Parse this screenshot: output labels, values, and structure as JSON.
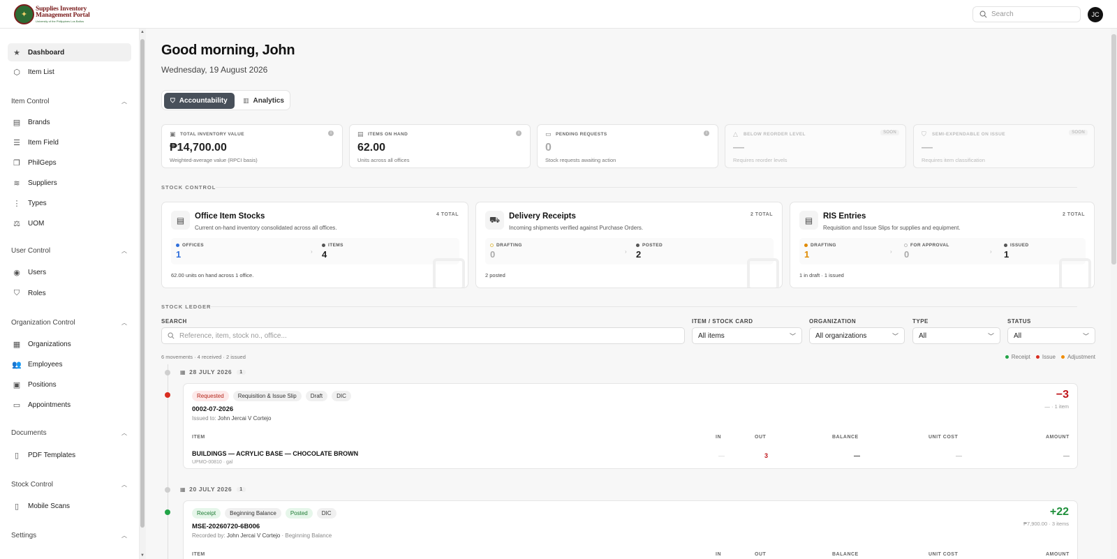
{
  "app": {
    "logo_line1": "Supplies Inventory",
    "logo_line2": "Management Portal",
    "logo_line3": "University of the Philippines Los Baños",
    "search_placeholder": "Search",
    "user_initials": "JC"
  },
  "sidebar": {
    "top_items": [
      {
        "label": "Dashboard",
        "icon": "star-icon"
      },
      {
        "label": "Item List",
        "icon": "box-icon"
      }
    ],
    "sections": [
      {
        "title": "Item Control",
        "items": [
          {
            "label": "Brands",
            "icon": "archive-icon"
          },
          {
            "label": "Item Field",
            "icon": "sliders-icon"
          },
          {
            "label": "PhilGeps",
            "icon": "files-icon"
          },
          {
            "label": "Suppliers",
            "icon": "stack-icon"
          },
          {
            "label": "Types",
            "icon": "list-icon"
          },
          {
            "label": "UOM",
            "icon": "scale-icon"
          }
        ]
      },
      {
        "title": "User Control",
        "items": [
          {
            "label": "Users",
            "icon": "user-circle-icon"
          },
          {
            "label": "Roles",
            "icon": "shield-icon"
          }
        ]
      },
      {
        "title": "Organization Control",
        "items": [
          {
            "label": "Organizations",
            "icon": "building-icon"
          },
          {
            "label": "Employees",
            "icon": "people-icon"
          },
          {
            "label": "Positions",
            "icon": "briefcase-icon"
          },
          {
            "label": "Appointments",
            "icon": "id-card-icon"
          }
        ]
      },
      {
        "title": "Documents",
        "items": [
          {
            "label": "PDF Templates",
            "icon": "document-icon"
          }
        ]
      },
      {
        "title": "Stock Control",
        "items": [
          {
            "label": "Mobile Scans",
            "icon": "phone-icon"
          }
        ]
      },
      {
        "title": "Settings",
        "items": []
      }
    ]
  },
  "header": {
    "greeting": "Good morning, John",
    "date": "Wednesday, 19 August 2026",
    "tabs": [
      "Accountability",
      "Analytics"
    ]
  },
  "kpis": [
    {
      "label": "TOTAL INVENTORY VALUE",
      "value": "₱14,700.00",
      "sub": "Weighted-average value (RPCI basis)",
      "icon": "wallet-icon",
      "state": "info"
    },
    {
      "label": "ITEMS ON HAND",
      "value": "62.00",
      "sub": "Units across all offices",
      "icon": "archive-icon",
      "state": "info"
    },
    {
      "label": "PENDING REQUESTS",
      "value": "0",
      "sub": "Stock requests awaiting action",
      "icon": "inbox-icon",
      "state": "info"
    },
    {
      "label": "BELOW REORDER LEVEL",
      "value": "—",
      "sub": "Requires reorder levels",
      "icon": "warning-icon",
      "state": "SOON"
    },
    {
      "label": "SEMI-EXPENDABLE ON ISSUE",
      "value": "—",
      "sub": "Requires item classification",
      "icon": "check-shield-icon",
      "state": "SOON"
    }
  ],
  "stock_control": {
    "label": "STOCK CONTROL",
    "cards": [
      {
        "title": "Office Item Stocks",
        "desc": "Current on-hand inventory consolidated across all offices.",
        "total": "4 TOTAL",
        "icon": "archive-icon",
        "stats": [
          {
            "label": "OFFICES",
            "value": "1",
            "color": "#2f6fdb"
          },
          {
            "label": "ITEMS",
            "value": "4",
            "color": "#555555"
          }
        ],
        "foot": "62.00 units on hand across 1 office."
      },
      {
        "title": "Delivery Receipts",
        "desc": "Incoming shipments verified against Purchase Orders.",
        "total": "2 TOTAL",
        "icon": "truck-icon",
        "stats": [
          {
            "label": "DRAFTING",
            "value": "0",
            "color": "#e0c15a"
          },
          {
            "label": "POSTED",
            "value": "2",
            "color": "#555555"
          }
        ],
        "foot": "2 posted"
      },
      {
        "title": "RIS Entries",
        "desc": "Requisition and Issue Slips for supplies and equipment.",
        "total": "2 TOTAL",
        "icon": "clipboard-icon",
        "stats": [
          {
            "label": "DRAFTING",
            "value": "1",
            "color": "#e08a00"
          },
          {
            "label": "FOR APPROVAL",
            "value": "0",
            "color": "#bbbbbb"
          },
          {
            "label": "ISSUED",
            "value": "1",
            "color": "#555555"
          }
        ],
        "foot": "1 in draft · 1 issued"
      }
    ]
  },
  "ledger": {
    "label": "STOCK LEDGER",
    "filters": {
      "search_label": "SEARCH",
      "search_placeholder": "Reference, item, stock no., office...",
      "item_label": "ITEM / STOCK CARD",
      "item_value": "All items",
      "org_label": "ORGANIZATION",
      "org_value": "All organizations",
      "type_label": "TYPE",
      "type_value": "All",
      "status_label": "STATUS",
      "status_value": "All"
    },
    "summary": "6 movements · 4 received · 2 issued",
    "legend": [
      {
        "label": "Receipt",
        "color": "#22a447"
      },
      {
        "label": "Issue",
        "color": "#d92d20"
      },
      {
        "label": "Adjustment",
        "color": "#f08c00"
      }
    ],
    "groups": [
      {
        "date": "28 JULY 2026",
        "count": "1",
        "entry": {
          "badges": [
            "Requested",
            "Requisition & Issue Slip",
            "Draft",
            "DIC"
          ],
          "ref": "0002-07-2026",
          "by_label": "Issued to:",
          "by_name": "John Jercai V Cortejo",
          "by_extra": "",
          "delta": "−3",
          "delta_color": "#c0161c",
          "delta_sub": "— · 1 item",
          "columns": [
            "ITEM",
            "IN",
            "OUT",
            "BALANCE",
            "UNIT COST",
            "AMOUNT"
          ],
          "row": {
            "name": "BUILDINGS — ACRYLIC BASE — CHOCOLATE BROWN",
            "sku": "UPMO-00810 · gal",
            "in": "—",
            "out": "3",
            "balance": "—",
            "unit_cost": "—",
            "amount": "—"
          }
        }
      },
      {
        "date": "20 JULY 2026",
        "count": "1",
        "entry": {
          "badges": [
            "Receipt",
            "Beginning Balance",
            "Posted",
            "DIC"
          ],
          "ref": "MSE-20260720-6B006",
          "by_label": "Recorded by:",
          "by_name": "John Jercai V Cortejo",
          "by_extra": "· Beginning Balance",
          "delta": "+22",
          "delta_color": "#1e8f3a",
          "delta_sub": "₱7,900.00 · 3 items",
          "columns": [
            "ITEM",
            "IN",
            "OUT",
            "BALANCE",
            "UNIT COST",
            "AMOUNT"
          ]
        }
      }
    ]
  }
}
